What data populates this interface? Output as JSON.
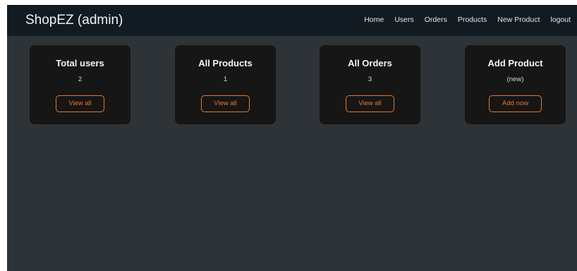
{
  "navbar": {
    "brand": "ShopEZ (admin)",
    "links": [
      "Home",
      "Users",
      "Orders",
      "Products",
      "New Product",
      "logout"
    ]
  },
  "cards": [
    {
      "title": "Total users",
      "value": "2",
      "button": "View all"
    },
    {
      "title": "All Products",
      "value": "1",
      "button": "View all"
    },
    {
      "title": "All Orders",
      "value": "3",
      "button": "View all"
    },
    {
      "title": "Add Product",
      "value": "(new)",
      "button": "Add now"
    }
  ],
  "colors": {
    "navbar_bg": "#121a22",
    "page_bg": "#2e3337",
    "card_bg": "#161616",
    "accent": "#e8762b"
  }
}
